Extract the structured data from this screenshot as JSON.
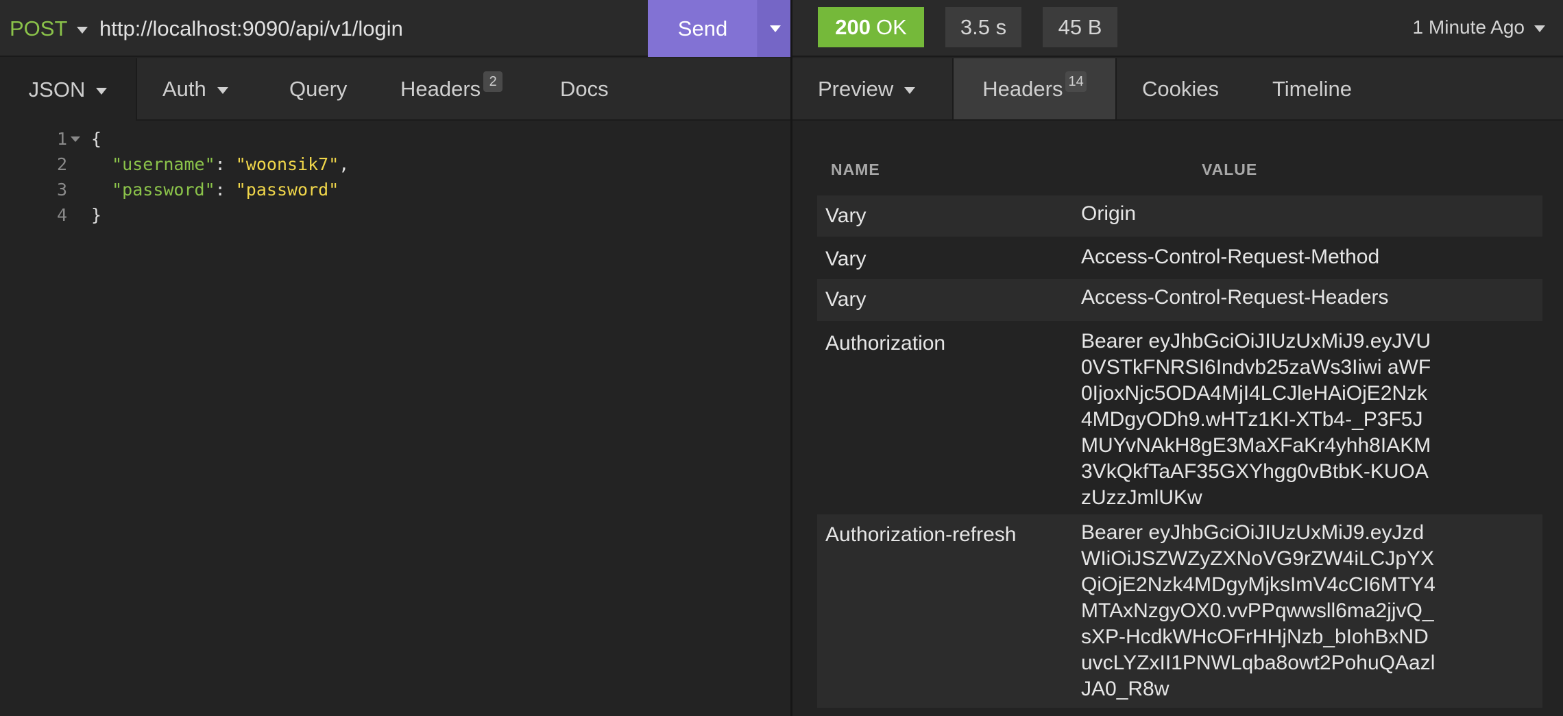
{
  "request": {
    "method": "POST",
    "url": "http://localhost:9090/api/v1/login",
    "send_label": "Send"
  },
  "response_meta": {
    "status_code": "200",
    "status_text": "OK",
    "time": "3.5 s",
    "size": "45 B",
    "received": "1 Minute Ago"
  },
  "request_tabs": {
    "json": "JSON",
    "auth": "Auth",
    "query": "Query",
    "headers": "Headers",
    "headers_count": "2",
    "docs": "Docs"
  },
  "response_tabs": {
    "preview": "Preview",
    "headers": "Headers",
    "headers_count": "14",
    "cookies": "Cookies",
    "timeline": "Timeline"
  },
  "editor": {
    "line_numbers": [
      "1",
      "2",
      "3",
      "4"
    ],
    "open_brace": "{",
    "close_brace": "}",
    "username_key": "\"username\"",
    "username_value": "\"woonsik7\"",
    "password_key": "\"password\"",
    "password_value": "\"password\"",
    "colon": ": ",
    "comma": ","
  },
  "response_headers": {
    "col_name": "NAME",
    "col_value": "VALUE",
    "rows": [
      {
        "name": "Vary",
        "value": "Origin"
      },
      {
        "name": "Vary",
        "value": "Access-Control-Request-Method"
      },
      {
        "name": "Vary",
        "value": "Access-Control-Request-Headers"
      },
      {
        "name": "Authorization",
        "value": "Bearer eyJhbGciOiJIUzUxMiJ9.eyJVU0VSTkFNRSI6Indvb25zaWs3Iiwi aWF0IjoxNjc5ODA4MjI4LCJleHAiOjE2Nzk4MDgyODh9.wHTz1KI-XTb4-_P3F5JMUYvNAkH8gE3MaXFaKr4yhh8IAKM3VkQkfTaAF35GXYhgg0vBtbK-KUOAzUzzJmlUKw"
      },
      {
        "name": "Authorization-refresh",
        "value": "Bearer eyJhbGciOiJIUzUxMiJ9.eyJzdWIiOiJSZWZyZXNoVG9rZW4iLCJpYXQiOjE2Nzk4MDgyMjksImV4cCI6MTY4MTAxNzgyOX0.vvPPqwwsll6ma2jjvQ_sXP-HcdkWHcOFrHHjNzb_bIohBxNDuvcLYZxII1PNWLqba8owt2PohuQAazlJA0_R8w"
      }
    ]
  },
  "colors": {
    "accent_send": "#8272d4",
    "status_ok": "#75b93a",
    "method_post": "#8bc34a",
    "json_key": "#8bc34a",
    "json_string": "#f0d64a"
  }
}
